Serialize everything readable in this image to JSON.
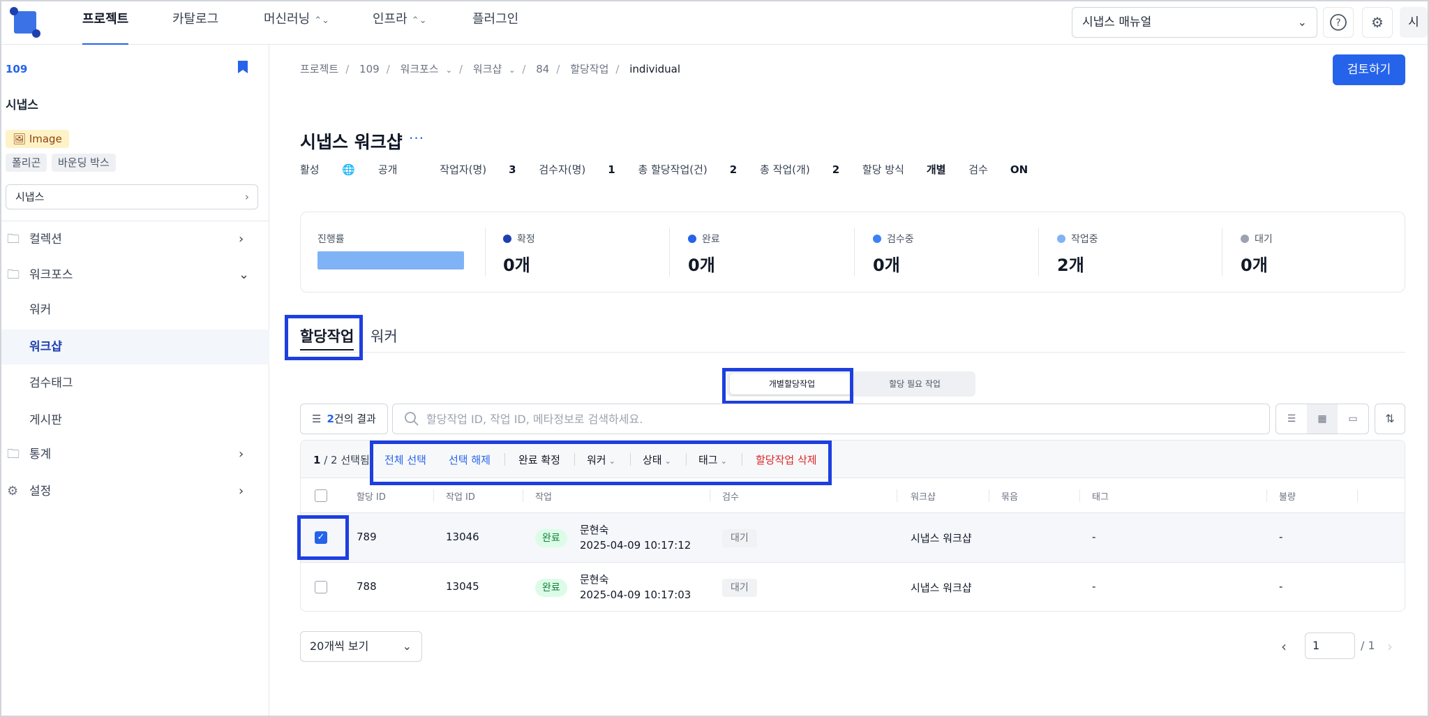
{
  "nav": {
    "tabs": [
      {
        "label": "프로젝트",
        "active": true,
        "dropdown": false
      },
      {
        "label": "카탈로그",
        "active": false,
        "dropdown": false
      },
      {
        "label": "머신러닝",
        "active": false,
        "dropdown": true
      },
      {
        "label": "인프라",
        "active": false,
        "dropdown": true
      },
      {
        "label": "플러그인",
        "active": false,
        "dropdown": false
      }
    ],
    "manual_select": "시냅스 매뉴얼",
    "help_icon": "help-circle-icon",
    "settings_icon": "gear-icon",
    "avatar_label": "시"
  },
  "sidebar": {
    "project_id": "109",
    "project_name": "시냅스",
    "data_type_badge": "Image",
    "tags": [
      "폴리곤",
      "바운딩 박스"
    ],
    "selector": "시냅스",
    "items": [
      {
        "label": "컬렉션",
        "icon": "folder-icon",
        "expanded": false
      },
      {
        "label": "워크포스",
        "icon": "folder-icon",
        "expanded": true
      },
      {
        "label": "통계",
        "icon": "folder-icon",
        "expanded": false
      },
      {
        "label": "설정",
        "icon": "gear-icon",
        "expanded": false
      }
    ],
    "subitems": [
      {
        "label": "워커",
        "active": false
      },
      {
        "label": "워크샵",
        "active": true
      },
      {
        "label": "검수태그",
        "active": false
      },
      {
        "label": "게시판",
        "active": false
      }
    ]
  },
  "breadcrumb": [
    "프로젝트",
    "109",
    "워크포스",
    "워크샵",
    "84",
    "할당작업",
    "individual"
  ],
  "review_button": "검토하기",
  "page_title": "시냅스 워크샵",
  "meta": {
    "status": "활성",
    "visibility": "공개",
    "workers_label": "작업자(명)",
    "workers_value": "3",
    "reviewers_label": "검수자(명)",
    "reviewers_value": "1",
    "assignments_label": "총 할당작업(건)",
    "assignments_value": "2",
    "tasks_label": "총 작업(개)",
    "tasks_value": "2",
    "method_label": "할당 방식",
    "method_value": "개별",
    "review_label": "검수",
    "review_value": "ON"
  },
  "stats": {
    "progress_label": "진행률",
    "items": [
      {
        "label": "확정",
        "value": "0개",
        "color": "#1e40af"
      },
      {
        "label": "완료",
        "value": "0개",
        "color": "#2563eb"
      },
      {
        "label": "검수중",
        "value": "0개",
        "color": "#3b82f6"
      },
      {
        "label": "작업중",
        "value": "2개",
        "color": "#7fb3f5"
      },
      {
        "label": "대기",
        "value": "0개",
        "color": "#9ca3af"
      }
    ]
  },
  "tabs": {
    "active": "할당작업",
    "inactive": "워커"
  },
  "segment": {
    "options": [
      "개별할당작업",
      "할당 필요 작업"
    ],
    "selected": "개별할당작업"
  },
  "filter": {
    "count": "2",
    "suffix": "건의 결과"
  },
  "search": {
    "placeholder": "할당작업 ID, 작업 ID, 메타정보로 검색하세요.",
    "value": ""
  },
  "actionbar": {
    "selected": "1",
    "total": "/ 2",
    "selected_suffix": "선택됨",
    "select_all": "전체 선택",
    "deselect": "선택 해제",
    "confirm": "완료 확정",
    "worker": "워커",
    "status": "상태",
    "tag": "태그",
    "delete": "할당작업 삭제"
  },
  "table": {
    "columns": [
      "할당 ID",
      "작업 ID",
      "작업",
      "검수",
      "워크샵",
      "묶음",
      "태그",
      "불량"
    ],
    "rows": [
      {
        "checked": true,
        "assign_id": "789",
        "task_id": "13046",
        "status": "완료",
        "worker": "문현숙",
        "time": "2025-04-09 10:17:12",
        "review": "대기",
        "workshop": "시냅스 워크샵",
        "bundle": "",
        "tag": "-",
        "defect": "-"
      },
      {
        "checked": false,
        "assign_id": "788",
        "task_id": "13045",
        "status": "완료",
        "worker": "문현숙",
        "time": "2025-04-09 10:17:03",
        "review": "대기",
        "workshop": "시냅스 워크샵",
        "bundle": "",
        "tag": "-",
        "defect": "-"
      }
    ]
  },
  "pagination": {
    "page_size": "20개씩 보기",
    "page": "1",
    "total": "/ 1"
  }
}
